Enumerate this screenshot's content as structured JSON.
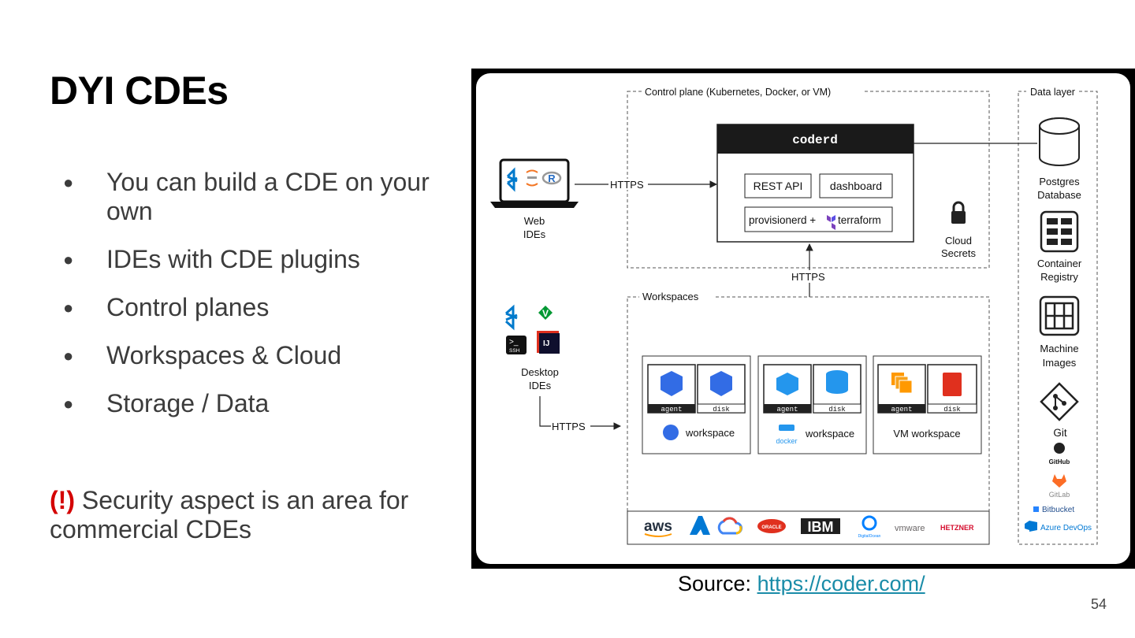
{
  "slide": {
    "title": "DYI CDEs",
    "bullets": [
      "You can build a CDE on your own",
      "IDEs with CDE plugins",
      "Control planes",
      "Workspaces & Cloud",
      "Storage / Data"
    ],
    "bullet_glyph": "●",
    "note_marker": "(!)",
    "note_text": " Security aspect is an area for commercial CDEs",
    "source_label": "Source: ",
    "source_link": "https://coder.com/",
    "page_number": "54"
  },
  "diagram": {
    "control_plane_label": "Control plane (Kubernetes, Docker, or VM)",
    "data_layer_label": "Data layer",
    "coderd_label": "coderd",
    "rest_api_label": "REST API",
    "dashboard_label": "dashboard",
    "provisionerd_label": "provisionerd + ",
    "terraform_label": "terraform",
    "cloud_secrets_line1": "Cloud",
    "cloud_secrets_line2": "Secrets",
    "https_label": "HTTPS",
    "web_ides_line1": "Web",
    "web_ides_line2": "IDEs",
    "desktop_ides_line1": "Desktop",
    "desktop_ides_line2": "IDEs",
    "workspaces_label": "Workspaces",
    "agent_label": "agent",
    "disk_label": "disk",
    "k8s_workspace_label": "workspace",
    "docker_workspace_label": "workspace",
    "docker_logo_text": "docker",
    "vm_workspace_label": "VM workspace",
    "postgres_line1": "Postgres",
    "postgres_line2": "Database",
    "registry_line1": "Container",
    "registry_line2": "Registry",
    "images_line1": "Machine",
    "images_line2": "Images",
    "git_label": "Git",
    "github_label": "GitHub",
    "gitlab_label": "GitLab",
    "bitbucket_label": "Bitbucket",
    "azure_devops_label": "Azure DevOps",
    "ssh_label": "SSH",
    "ij_label": "IJ",
    "cloud_providers": {
      "aws": "aws",
      "oracle": "ORACLE",
      "ibm": "IBM",
      "digitalocean": "DigitalOcean",
      "vmware": "vmware",
      "hetzner": "HETZNER"
    },
    "colors": {
      "k8s_blue": "#326ce5",
      "docker_blue": "#2496ed",
      "aws_orange": "#ff9900",
      "azure_blue": "#0078d4",
      "oracle_red": "#e0301e",
      "hetzner_red": "#d50c2d",
      "gitlab_orange": "#fc6d26",
      "terraform_purple": "#7b42bc",
      "vscode_blue": "#007acc"
    }
  }
}
